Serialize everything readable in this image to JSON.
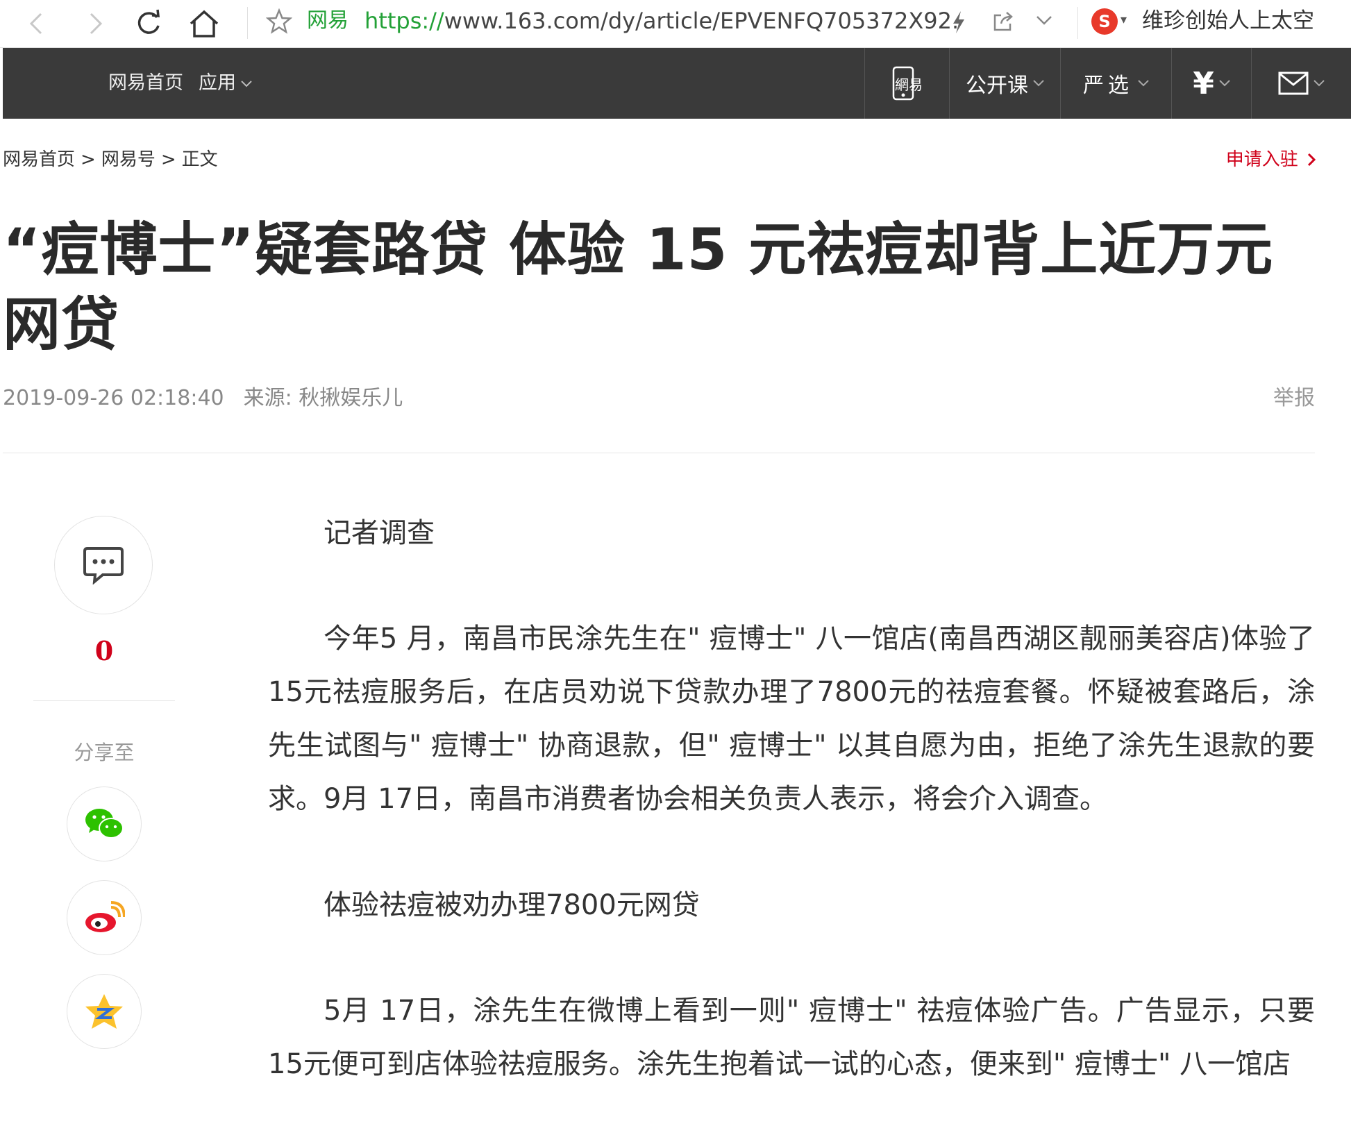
{
  "browser": {
    "site_name": "网易",
    "url_protocol": "https://",
    "url_path": "www.163.com/dy/article/EPVENFQ705372X92.",
    "search_hint": "维珍创始人上太空",
    "search_logo_letter": "S"
  },
  "topnav": {
    "home": "网易首页",
    "apps": "应用",
    "mobile_logo": "網易",
    "open_course": "公开课",
    "yanxuan": "严选",
    "finance_symbol": "¥",
    "accent_color": "#3a3a3a"
  },
  "breadcrumb": {
    "items": [
      "网易首页",
      "网易号",
      "正文"
    ],
    "separator": ">",
    "apply_label": "申请入驻"
  },
  "article": {
    "title": "“痘博士”疑套路贷 体验 15 元祛痘却背上近万元网贷",
    "timestamp": "2019-09-26 02:18:40",
    "source": "来源: 秋揪娱乐儿",
    "report_label": "举报",
    "paragraphs": [
      {
        "type": "sub",
        "text": "记者调查"
      },
      {
        "type": "body",
        "text": "今年5 月，南昌市民涂先生在\" 痘博士\" 八一馆店(南昌西湖区靓丽美容店)体验了15元祛痘服务后，在店员劝说下贷款办理了7800元的祛痘套餐。怀疑被套路后，涂先生试图与\" 痘博士\" 协商退款，但\" 痘博士\" 以其自愿为由，拒绝了涂先生退款的要求。9月 17日，南昌市消费者协会相关负责人表示，将会介入调查。"
      },
      {
        "type": "sub",
        "text": "体验祛痘被劝办理7800元网贷"
      },
      {
        "type": "body",
        "text": "5月 17日，涂先生在微博上看到一则\" 痘博士\" 祛痘体验广告。广告显示，只要15元便可到店体验祛痘服务。涂先生抱着试一试的心态，便来到\" 痘博士\" 八一馆店"
      }
    ]
  },
  "sidebar": {
    "comment_count": "0",
    "share_label": "分享至",
    "share_targets": [
      "wechat-icon",
      "weibo-icon",
      "qzone-icon"
    ]
  },
  "colors": {
    "brand_red": "#d0021b",
    "url_green": "#23a137",
    "nav_bg": "#3a3a3a"
  }
}
